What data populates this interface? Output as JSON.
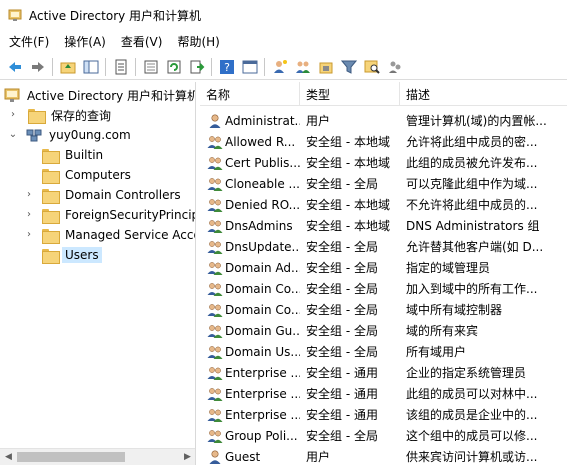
{
  "window": {
    "title": "Active Directory 用户和计算机"
  },
  "menu": [
    {
      "label": "文件(F)"
    },
    {
      "label": "操作(A)"
    },
    {
      "label": "查看(V)"
    },
    {
      "label": "帮助(H)"
    }
  ],
  "toolbar": {
    "buttons": [
      {
        "icon": "back-arrow-icon"
      },
      {
        "icon": "forward-arrow-icon"
      },
      {
        "icon": "up-folder-icon"
      },
      {
        "icon": "console-tree-icon"
      },
      {
        "icon": "properties-doc-icon"
      },
      {
        "icon": "export-list-icon"
      },
      {
        "icon": "refresh-icon"
      },
      {
        "icon": "export-icon"
      },
      {
        "icon": "help-icon"
      },
      {
        "icon": "show-hide-icon"
      },
      {
        "icon": "new-user-icon"
      },
      {
        "icon": "new-group-icon"
      },
      {
        "icon": "new-ou-icon"
      },
      {
        "icon": "filter-icon"
      },
      {
        "icon": "find-icon"
      },
      {
        "icon": "add-to-group-icon"
      }
    ]
  },
  "tree": {
    "root": "Active Directory 用户和计算机",
    "saved_queries": "保存的查询",
    "domain": "yuy0ung.com",
    "items": [
      {
        "label": "Builtin",
        "expandable": false
      },
      {
        "label": "Computers",
        "expandable": false
      },
      {
        "label": "Domain Controllers",
        "expandable": true
      },
      {
        "label": "ForeignSecurityPrincipa",
        "expandable": true
      },
      {
        "label": "Managed Service Acco",
        "expandable": true
      },
      {
        "label": "Users",
        "expandable": false,
        "selected": true
      }
    ]
  },
  "list": {
    "columns": [
      "名称",
      "类型",
      "描述"
    ],
    "rows": [
      {
        "name": "Administrat...",
        "type": "用户",
        "desc": "管理计算机(域)的内置帐...",
        "icon": "user-icon"
      },
      {
        "name": "Allowed R...",
        "type": "安全组 - 本地域",
        "desc": "允许将此组中成员的密...",
        "icon": "group-icon"
      },
      {
        "name": "Cert Publis...",
        "type": "安全组 - 本地域",
        "desc": "此组的成员被允许发布...",
        "icon": "group-icon"
      },
      {
        "name": "Cloneable ...",
        "type": "安全组 - 全局",
        "desc": "可以克隆此组中作为域...",
        "icon": "group-icon"
      },
      {
        "name": "Denied RO...",
        "type": "安全组 - 本地域",
        "desc": "不允许将此组中成员的...",
        "icon": "group-icon"
      },
      {
        "name": "DnsAdmins",
        "type": "安全组 - 本地域",
        "desc": "DNS Administrators 组",
        "icon": "group-icon"
      },
      {
        "name": "DnsUpdate...",
        "type": "安全组 - 全局",
        "desc": "允许替其他客户端(如 D...",
        "icon": "group-icon"
      },
      {
        "name": "Domain Ad...",
        "type": "安全组 - 全局",
        "desc": "指定的域管理员",
        "icon": "group-icon"
      },
      {
        "name": "Domain Co...",
        "type": "安全组 - 全局",
        "desc": "加入到域中的所有工作...",
        "icon": "group-icon"
      },
      {
        "name": "Domain Co...",
        "type": "安全组 - 全局",
        "desc": "域中所有域控制器",
        "icon": "group-icon"
      },
      {
        "name": "Domain Gu...",
        "type": "安全组 - 全局",
        "desc": "域的所有来宾",
        "icon": "group-icon"
      },
      {
        "name": "Domain Us...",
        "type": "安全组 - 全局",
        "desc": "所有域用户",
        "icon": "group-icon"
      },
      {
        "name": "Enterprise ...",
        "type": "安全组 - 通用",
        "desc": "企业的指定系统管理员",
        "icon": "group-icon"
      },
      {
        "name": "Enterprise ...",
        "type": "安全组 - 通用",
        "desc": "此组的成员可以对林中...",
        "icon": "group-icon"
      },
      {
        "name": "Enterprise ...",
        "type": "安全组 - 通用",
        "desc": "该组的成员是企业中的...",
        "icon": "group-icon"
      },
      {
        "name": "Group Poli...",
        "type": "安全组 - 全局",
        "desc": "这个组中的成员可以修...",
        "icon": "group-icon"
      },
      {
        "name": "Guest",
        "type": "用户",
        "desc": "供来宾访问计算机或访...",
        "icon": "user-icon"
      }
    ]
  }
}
